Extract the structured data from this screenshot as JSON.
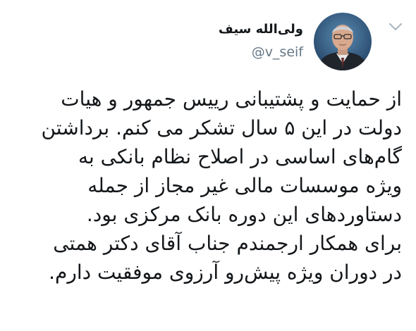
{
  "header": {
    "display_name": "ولی‌الله سیف",
    "handle": "@v_seif"
  },
  "tweet": {
    "lines": [
      "از حمایت و پشتیبانی رییس جمهور و هیات",
      "دولت در این ۵ سال تشکر می کنم. برداشتن",
      "گام‌های اساسی در اصلاح نظام بانکی به",
      "ویژه موسسات مالی غیر مجاز از جمله",
      "دستاوردهای این دوره بانک مرکزی بود.",
      "برای همکار ارجمندم جناب آقای دکتر همتی",
      "در دوران ویژه پیش‌رو آرزوی موفقیت دارم."
    ]
  },
  "icons": {
    "menu": "chevron-down-icon",
    "avatar": "profile-photo"
  },
  "colors": {
    "text": "#14171a",
    "handle": "#657786",
    "chevron": "#aab8c2",
    "background": "#ffffff"
  }
}
